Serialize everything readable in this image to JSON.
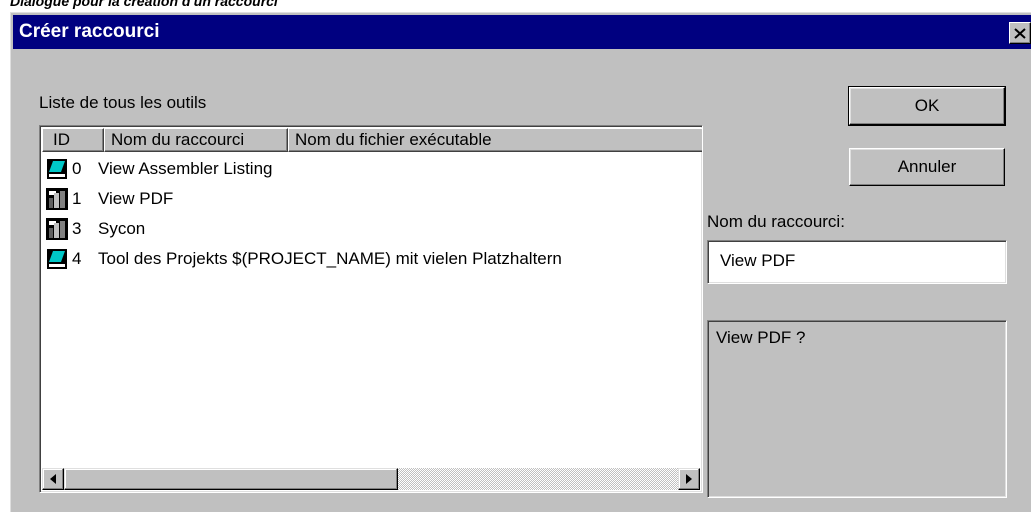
{
  "caption": "Dialogue pour la création d'un raccourci",
  "dialog": {
    "title": "Créer raccourci",
    "close_label": "X",
    "list_label": "Liste de tous les outils",
    "columns": [
      "ID",
      "Nom du raccourci",
      "Nom du fichier exécutable"
    ],
    "rows": [
      {
        "id": "0",
        "name": "View Assembler Listing",
        "icon": "editor-icon"
      },
      {
        "id": "1",
        "name": "View PDF",
        "icon": "tool-icon"
      },
      {
        "id": "3",
        "name": "Sycon",
        "icon": "tool-icon"
      },
      {
        "id": "4",
        "name": "Tool des Projekts $(PROJECT_NAME) mit vielen Platzhaltern",
        "icon": "editor-icon"
      }
    ],
    "ok_label": "OK",
    "cancel_label": "Annuler",
    "shortcut_name_label": "Nom du raccourci:",
    "shortcut_name_value": "View PDF",
    "info_text": "View PDF ?"
  },
  "colors": {
    "titlebar": "#000080",
    "dialog_bg": "#c0c0c0",
    "editor_icon": "#00c8c8"
  }
}
